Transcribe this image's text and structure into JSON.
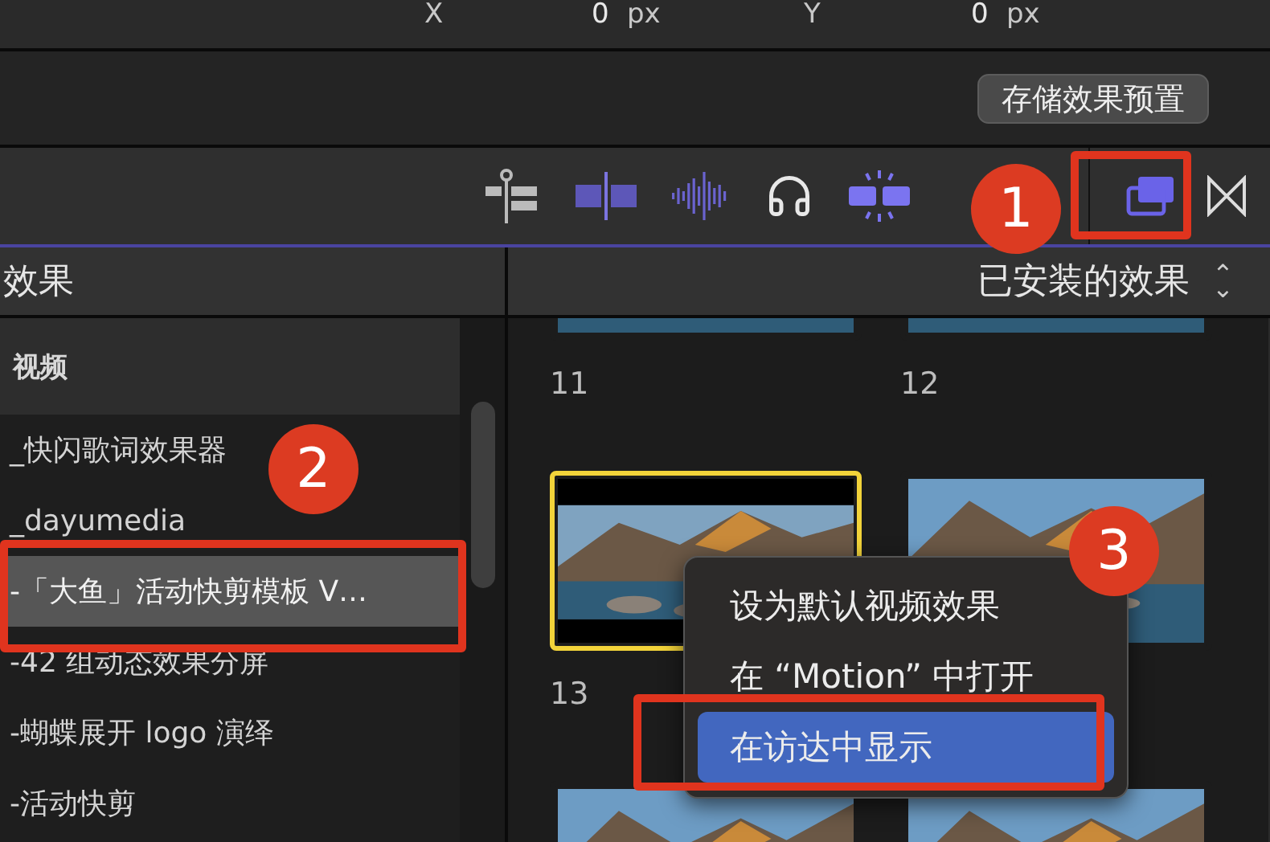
{
  "position_fields": [
    {
      "axis": "X",
      "value": "0",
      "unit": "px"
    },
    {
      "axis": "Y",
      "value": "0",
      "unit": "px"
    }
  ],
  "save_preset_button": "存储效果预置",
  "sidebar": {
    "title": "效果",
    "section": "视频",
    "items": [
      {
        "label": "_快闪歌词效果器",
        "selected": false
      },
      {
        "label": "_dayumedia",
        "selected": false
      },
      {
        "label": "-「大鱼」活动快剪模板 V…",
        "selected": true
      },
      {
        "label": "-42 组动态效果分屏",
        "selected": false
      },
      {
        "label": "-蝴蝶展开 logo 演绎",
        "selected": false
      },
      {
        "label": "-活动快剪",
        "selected": false
      }
    ]
  },
  "browser": {
    "filter": "已安装的效果",
    "filter_arrows": "⌃⌄",
    "tiles": [
      {
        "label": "11",
        "selected": false
      },
      {
        "label": "12",
        "selected": false
      },
      {
        "label": "13",
        "selected": true
      },
      {
        "selected": false
      },
      {
        "selected": false
      },
      {
        "selected": false
      }
    ]
  },
  "context_menu": [
    {
      "label": "设为默认视频效果",
      "selected": false
    },
    {
      "label": "在 “Motion” 中打开",
      "selected": false
    },
    {
      "label": "在访达中显示",
      "selected": true
    }
  ],
  "step_markers": [
    "1",
    "2",
    "3"
  ]
}
